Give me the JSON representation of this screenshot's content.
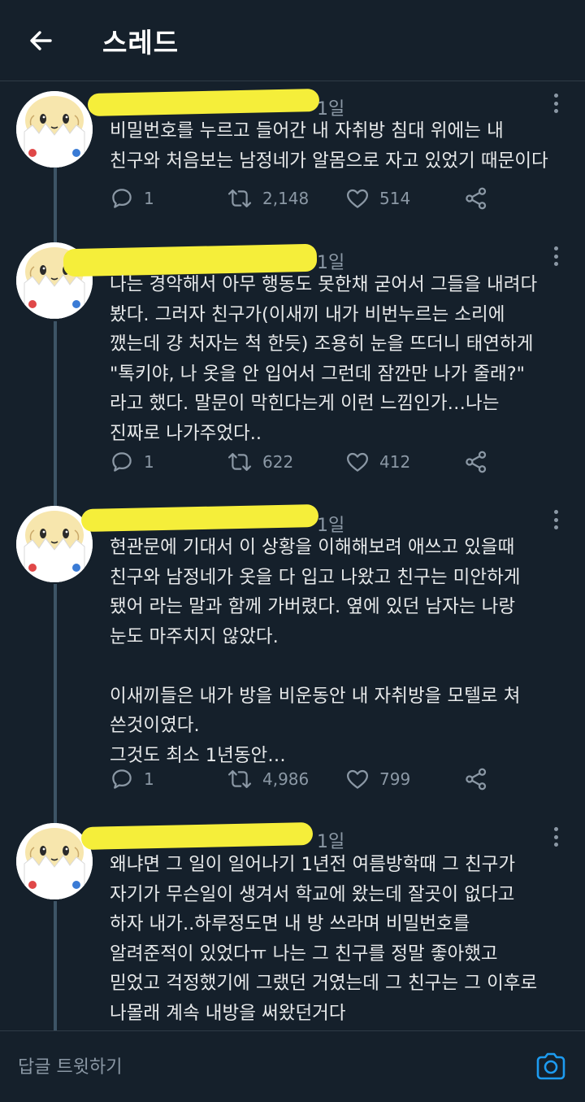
{
  "header": {
    "title": "스레드"
  },
  "tweets": [
    {
      "time": "1일",
      "text": "비밀번호를 누르고 들어간 내 자취방 침대 위에는 내\n친구와 처음보는 남정네가 알몸으로 자고 있었기 때문이다",
      "replies": "1",
      "retweets": "2,148",
      "likes": "514"
    },
    {
      "time": "1일",
      "text": "나는 경악해서 아무 행동도 못한채 굳어서 그들을 내려다\n봤다. 그러자 친구가(이새끼 내가 비번누르는 소리에\n깼는데 걍 처자는 척 한듯) 조용히 눈을 뜨더니 태연하게\n\"톡키야, 나 옷을 안 입어서 그런데 잠깐만 나가 줄래?\"\n라고 했다. 말문이 막힌다는게 이런 느낌인가…나는\n진짜로 나가주었다..",
      "replies": "1",
      "retweets": "622",
      "likes": "412"
    },
    {
      "time": "1일",
      "text": "현관문에 기대서 이 상황을 이해해보려 애쓰고 있을때\n친구와 남정네가 옷을 다 입고 나왔고 친구는 미안하게\n됐어 라는 말과 함께 가버렸다. 옆에 있던 남자는 나랑\n눈도 마주치지 않았다.\n\n이새끼들은 내가 방을 비운동안 내 자취방을 모텔로 쳐\n쓴것이였다.\n그것도 최소 1년동안…",
      "replies": "1",
      "retweets": "4,986",
      "likes": "799"
    },
    {
      "time": "1일",
      "text": "왜냐면 그 일이 일어나기 1년전 여름방학때 그 친구가\n자기가 무슨일이 생겨서 학교에 왔는데 잘곳이 없다고\n하자 내가..하루정도면 내 방 쓰라며 비밀번호를\n알려준적이 있었다ㅠ 나는 그 친구를 정말 좋아했고\n믿었고 걱정했기에 그랬던 거였는데 그 친구는 그 이후로\n나몰래 계속 내방을 써왔던거다"
    }
  ],
  "compose": {
    "placeholder": "답글 트윗하기"
  },
  "colors": {
    "background": "#15202b",
    "muted": "#8b98a5",
    "accent": "#1d9bf0",
    "redaction": "#f5ee3a"
  },
  "icons": {
    "back": "arrow-left-icon",
    "reply": "reply-icon",
    "retweet": "retweet-icon",
    "like": "heart-icon",
    "share": "share-icon",
    "more": "more-vertical-icon",
    "camera": "camera-icon"
  }
}
